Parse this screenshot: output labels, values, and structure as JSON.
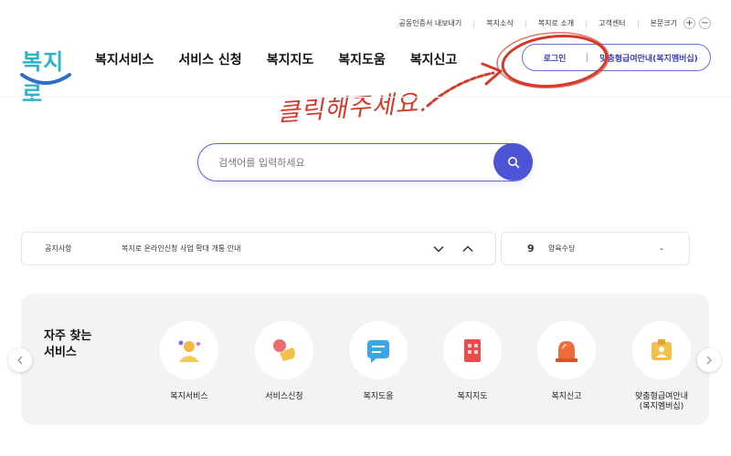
{
  "util_links": [
    "공동인증서 내보내기",
    "복지소식",
    "복지로 소개",
    "고객센터",
    "본문크기"
  ],
  "zoom_in": "+",
  "zoom_out": "−",
  "logo": "복지로",
  "nav": [
    "복지서비스",
    "서비스 신청",
    "복지지도",
    "복지도움",
    "복지신고"
  ],
  "header": {
    "login": "로그인",
    "member": "맞춤형급여안내(복지멤버십)"
  },
  "annotation": "클릭해주세요.",
  "search": {
    "placeholder": "검색어를 입력하세요"
  },
  "notice": {
    "label": "공지사항",
    "text": "복지로 온라인신청 사업 확대 개통 안내"
  },
  "counter": {
    "number": "9",
    "label": "양육수당",
    "dash": "-"
  },
  "services": {
    "title_line1": "자주 찾는",
    "title_line2": "서비스",
    "items": [
      {
        "name": "복지서비스",
        "icon": "person-service-icon"
      },
      {
        "name": "서비스신청",
        "icon": "hand-apply-icon"
      },
      {
        "name": "복지도움",
        "icon": "chat-bubble-icon"
      },
      {
        "name": "복지지도",
        "icon": "building-map-icon"
      },
      {
        "name": "복지신고",
        "icon": "siren-icon"
      },
      {
        "name": "맞춤형급여안내\n(복지멤버십)",
        "icon": "id-card-icon"
      }
    ]
  },
  "colors": {
    "brand": "#2db3c7",
    "accent": "#4d55d6",
    "annotation": "#d43a2a"
  }
}
